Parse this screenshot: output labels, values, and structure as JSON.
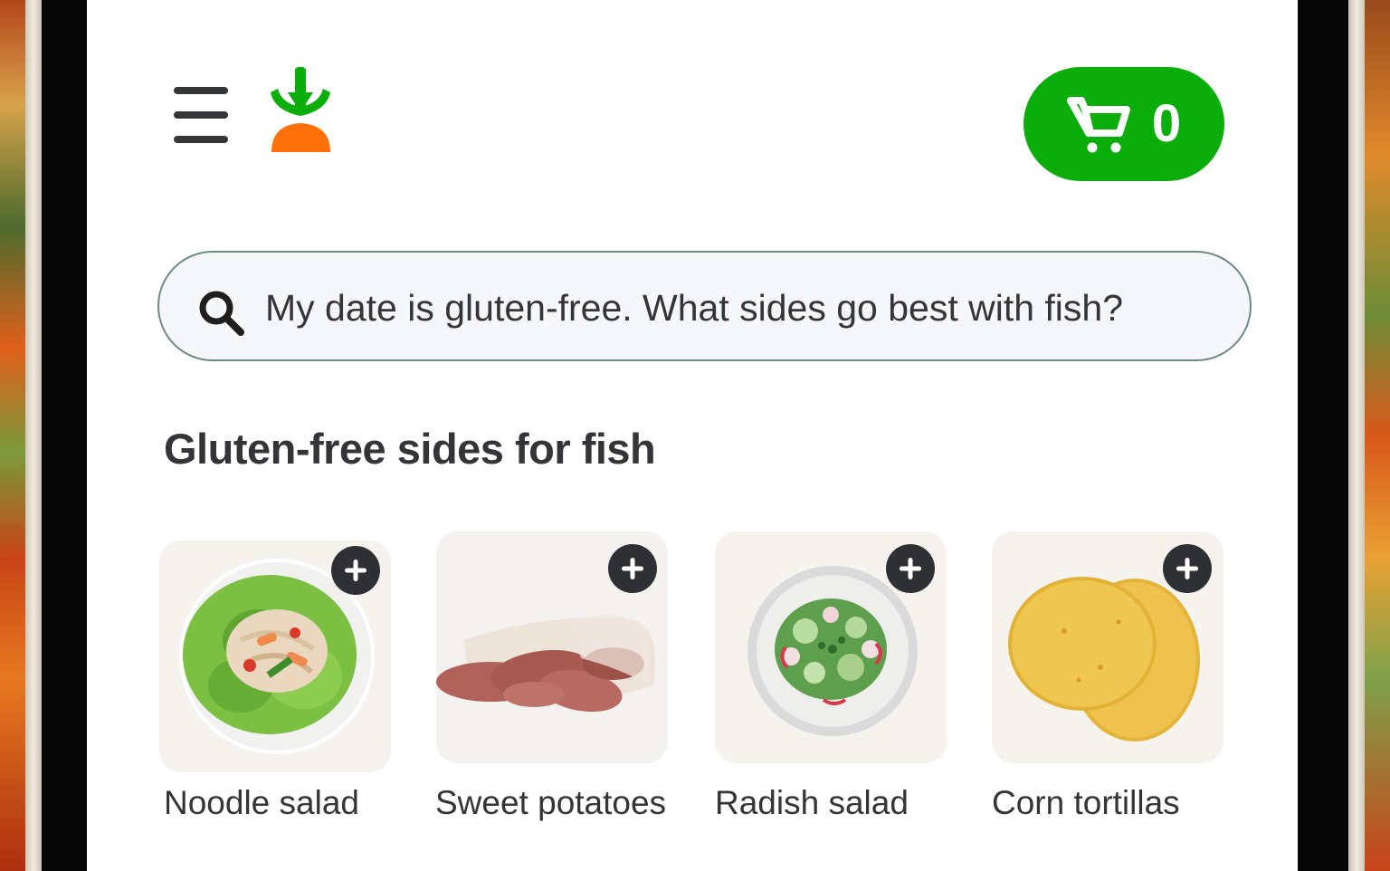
{
  "header": {
    "menu_icon": "hamburger-menu-icon",
    "logo_icon": "carrot-logo-icon",
    "cart": {
      "icon": "shopping-cart-icon",
      "count": "0",
      "color": "#0aad0a"
    }
  },
  "search": {
    "icon": "search-icon",
    "value": "My date is gluten-free. What sides go best with fish?"
  },
  "section": {
    "title": "Gluten-free sides for fish"
  },
  "products": [
    {
      "label": "Noodle salad",
      "add_icon": "plus-icon"
    },
    {
      "label": "Sweet potatoes",
      "add_icon": "plus-icon"
    },
    {
      "label": "Radish salad",
      "add_icon": "plus-icon"
    },
    {
      "label": "Corn tortillas",
      "add_icon": "plus-icon"
    }
  ]
}
